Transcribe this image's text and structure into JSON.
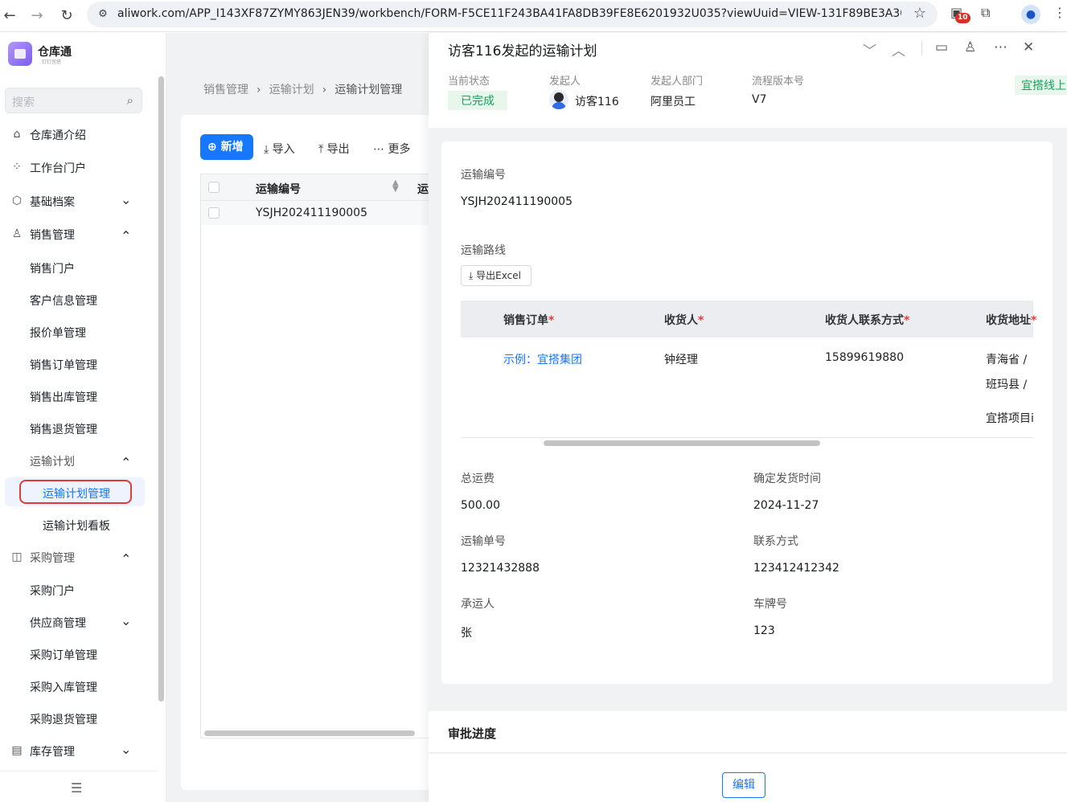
{
  "browser": {
    "url": "aliwork.com/APP_I143XF87ZYMY863JEN39/workbench/FORM-F5CE11F243BA41FA8DB39FE8E6201932U035?viewUuid=VIEW-131F89BE3A304...",
    "ext_badge": "10"
  },
  "app": {
    "name": "仓库通",
    "subtitle": "钉钉宜搭"
  },
  "sidebar": {
    "search_placeholder": "搜索",
    "items": [
      {
        "label": "仓库通介绍"
      },
      {
        "label": "工作台门户"
      },
      {
        "label": "基础档案"
      },
      {
        "label": "销售管理"
      },
      {
        "label": "销售门户"
      },
      {
        "label": "客户信息管理"
      },
      {
        "label": "报价单管理"
      },
      {
        "label": "销售订单管理"
      },
      {
        "label": "销售出库管理"
      },
      {
        "label": "销售退货管理"
      },
      {
        "label": "运输计划"
      },
      {
        "label": "运输计划管理"
      },
      {
        "label": "运输计划看板"
      },
      {
        "label": "采购管理"
      },
      {
        "label": "采购门户"
      },
      {
        "label": "供应商管理"
      },
      {
        "label": "采购订单管理"
      },
      {
        "label": "采购入库管理"
      },
      {
        "label": "采购退货管理"
      },
      {
        "label": "库存管理"
      }
    ]
  },
  "breadcrumb": [
    "销售管理",
    "运输计划",
    "运输计划管理"
  ],
  "toolbar": {
    "new_label": "新增",
    "import_label": "导入",
    "export_label": "导出",
    "more_label": "更多"
  },
  "table": {
    "columns": [
      "运输编号",
      "运"
    ],
    "rows": [
      [
        "YSJH202411190005"
      ]
    ]
  },
  "drawer": {
    "title": "访客116发起的运输计划",
    "meta": {
      "status_label": "当前状态",
      "status_value": "已完成",
      "initiator_label": "发起人",
      "initiator_value": "访客116",
      "dept_label": "发起人部门",
      "dept_value": "阿里员工",
      "version_label": "流程版本号",
      "version_value": "V7",
      "online_tag": "宜搭线上"
    },
    "form": {
      "transport_no_label": "运输编号",
      "transport_no_value": "YSJH202411190005",
      "route_label": "运输路线",
      "export_excel_label": "导出Excel",
      "route_columns": [
        "销售订单",
        "收货人",
        "收货人联系方式",
        "收货地址"
      ],
      "route_row": {
        "order": "示例：宜搭集团",
        "receiver": "钟经理",
        "phone": "15899619880",
        "address_line1": "青海省 /",
        "address_line2": "班玛县 /",
        "address_line3": "宜搭项目i"
      },
      "total_freight_label": "总运费",
      "total_freight_value": "500.00",
      "ship_time_label": "确定发货时间",
      "ship_time_value": "2024-11-27",
      "waybill_label": "运输单号",
      "waybill_value": "12321432888",
      "contact_label": "联系方式",
      "contact_value": "123412412342",
      "carrier_label": "承运人",
      "carrier_value": "张",
      "plate_label": "车牌号",
      "plate_value": "123"
    },
    "approval_title": "审批进度",
    "edit_label": "编辑"
  }
}
